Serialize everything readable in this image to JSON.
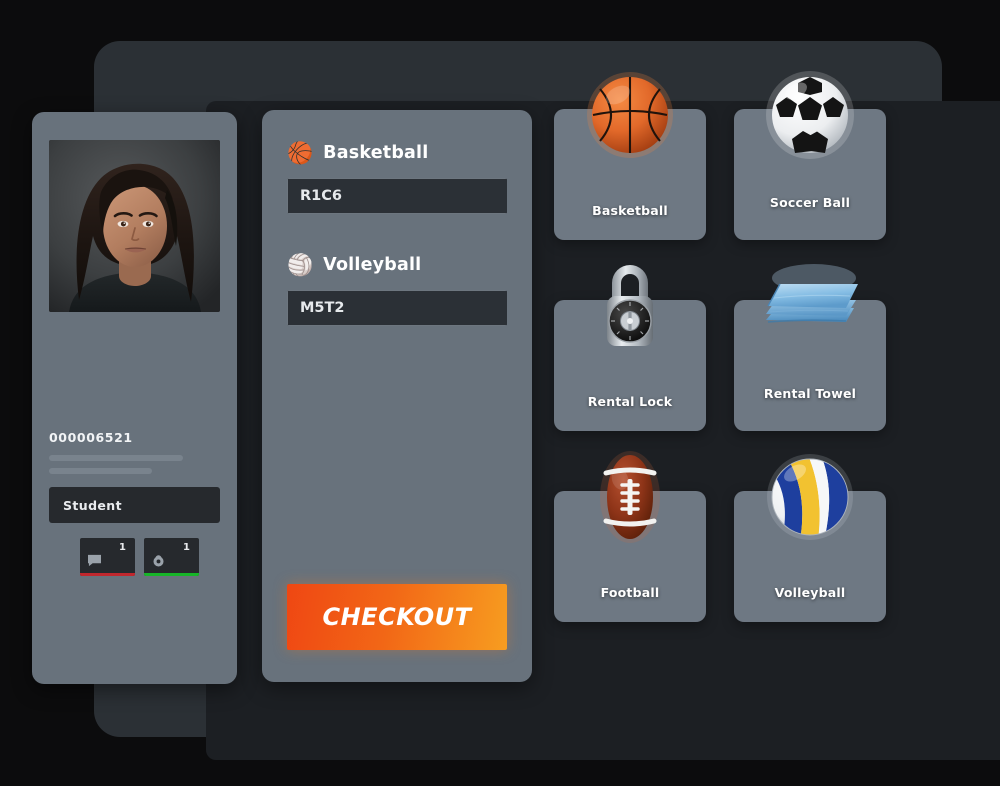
{
  "app": {
    "title": "Equipment Checkout Kiosk",
    "background_color": "#0c0c0d",
    "frame_color": "#2b3035",
    "screen_color": "#1c1f23",
    "card_color": "#68727c",
    "tile_color": "#6e7883",
    "accent_color": "#f2731a"
  },
  "profile": {
    "photo_alt": "student-portrait",
    "id_number": "000006521",
    "redacted_lines": 2,
    "role_label": "Student",
    "badges": [
      {
        "icon": "message-icon",
        "count": "1",
        "underline_color": "#c1272d"
      },
      {
        "icon": "lock-icon",
        "count": "1",
        "underline_color": "#16b528"
      }
    ]
  },
  "cart": {
    "items": [
      {
        "emoji": "🏀",
        "icon_name": "basketball-icon",
        "name": "Basketball",
        "code_value": "R1C6",
        "code_placeholder": "Code",
        "remove_icon": "close-icon"
      },
      {
        "emoji": "🏐",
        "icon_name": "volleyball-icon",
        "name": "Volleyball",
        "code_value": "M5T2",
        "code_placeholder": "Code",
        "remove_icon": "close-icon"
      }
    ],
    "checkout_label": "CHECKOUT"
  },
  "catalog": {
    "items": [
      {
        "label": "Basketball",
        "art": "basketball",
        "raised_label": false
      },
      {
        "label": "Soccer Ball",
        "art": "soccerball",
        "raised_label": true
      },
      {
        "label": "Rental Lock",
        "art": "lock",
        "raised_label": false
      },
      {
        "label": "Rental Towel",
        "art": "towel",
        "raised_label": true
      },
      {
        "label": "Football",
        "art": "football",
        "raised_label": false
      },
      {
        "label": "Volleyball",
        "art": "volleyball",
        "raised_label": false
      }
    ]
  }
}
